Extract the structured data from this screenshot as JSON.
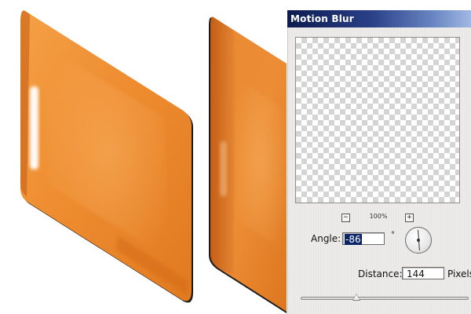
{
  "dialog": {
    "title": "Motion Blur",
    "zoom_level": "100%",
    "zoom_out_symbol": "−",
    "zoom_in_symbol": "+",
    "angle": {
      "label": "Angle:",
      "value": "-86",
      "unit": "°"
    },
    "distance": {
      "label": "Distance:",
      "value": "144",
      "unit": "Pixels",
      "slider_fraction": 0.33
    }
  },
  "icons": {
    "zoom_out": "minus-icon",
    "zoom_in": "plus-icon",
    "angle_dial": "angle-dial-icon"
  },
  "colors": {
    "panel_orange": "#ee8a2c",
    "panel_dark_orange": "#c8560e",
    "titlebar_dark": "#0c1c4e",
    "titlebar_light": "#a9bfe6",
    "selection": "#0a246a"
  }
}
